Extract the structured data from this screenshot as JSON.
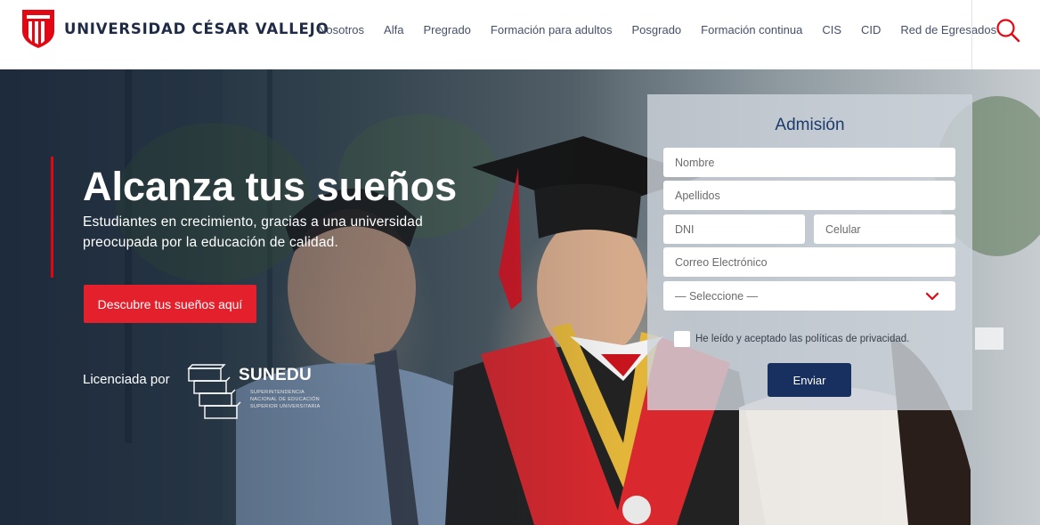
{
  "header": {
    "brand": "UNIVERSIDAD CÉSAR VALLEJO",
    "nav": [
      "Nosotros",
      "Alfa",
      "Pregrado",
      "Formación para adultos",
      "Posgrado",
      "Formación continua",
      "CIS",
      "CID",
      "Red de Egresados"
    ]
  },
  "hero": {
    "title": "Alcanza tus sueños",
    "subtitle": "Estudiantes en crecimiento, gracias a una universidad preocupada por la educación de calidad.",
    "cta": "Descubre tus sueños aquí",
    "licensed_label": "Licenciada por",
    "licensor": "SUNEDU",
    "licensor_subtext": "SUPERINTENDENCIA NACIONAL DE EDUCACIÓN SUPERIOR UNIVERSITARIA"
  },
  "form": {
    "title": "Admisión",
    "name_placeholder": "Nombre",
    "lastname_placeholder": "Apellidos",
    "dni_placeholder": "DNI",
    "phone_placeholder": "Celular",
    "email_placeholder": "Correo Electrónico",
    "select_value": "— Seleccione —",
    "consent_label": "He leído y aceptado las políticas de privacidad.",
    "submit": "Enviar"
  },
  "colors": {
    "brand_red": "#e30613",
    "navy": "#17305f",
    "nav_text": "#44506a"
  },
  "icons": [
    "ucv-shield-logo",
    "search-icon",
    "sunedu-logo",
    "chevron-down-icon"
  ]
}
